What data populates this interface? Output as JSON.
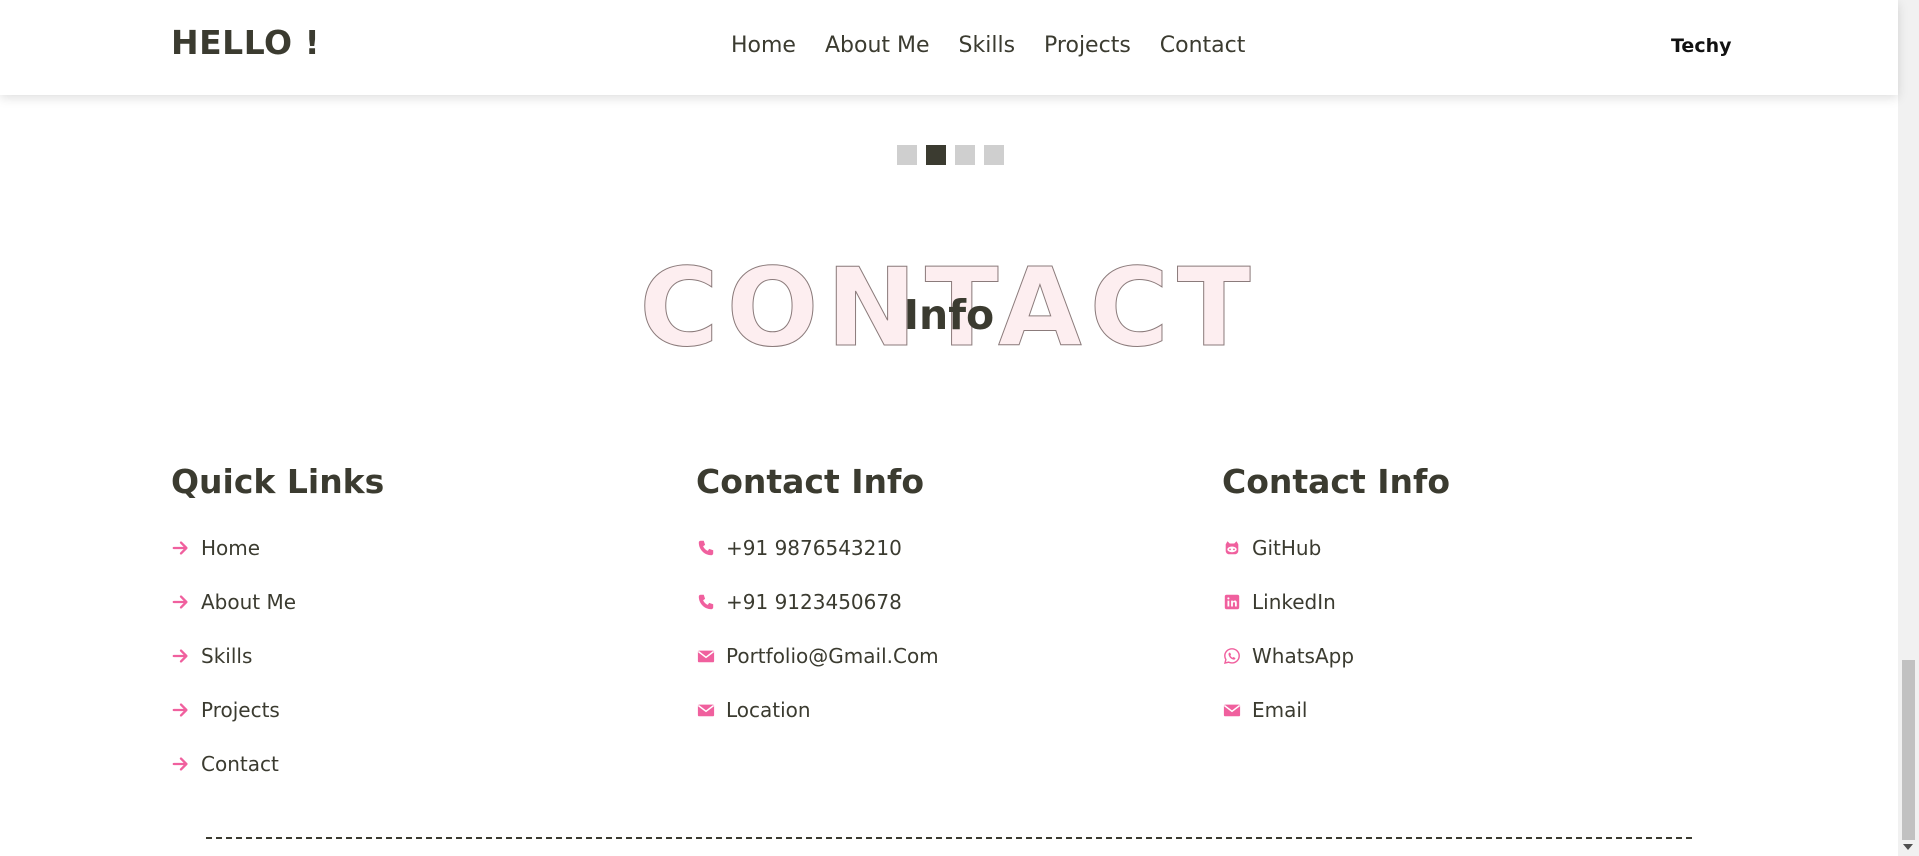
{
  "header": {
    "logo": "HELLO !",
    "nav": [
      "Home",
      "About Me",
      "Skills",
      "Projects",
      "Contact"
    ],
    "brand_right": "Techy"
  },
  "slider": {
    "dot_count": 4,
    "active_index": 1
  },
  "section": {
    "background_title": "CONTACT",
    "title": "Info"
  },
  "columns": [
    {
      "title": "Quick Links",
      "items": [
        {
          "icon": "arrow-right-icon",
          "label": "Home"
        },
        {
          "icon": "arrow-right-icon",
          "label": "About Me"
        },
        {
          "icon": "arrow-right-icon",
          "label": "Skills"
        },
        {
          "icon": "arrow-right-icon",
          "label": "Projects"
        },
        {
          "icon": "arrow-right-icon",
          "label": "Contact"
        }
      ]
    },
    {
      "title": "Contact Info",
      "items": [
        {
          "icon": "phone-icon",
          "label": "+91 9876543210"
        },
        {
          "icon": "phone-icon",
          "label": "+91 9123450678"
        },
        {
          "icon": "envelope-icon",
          "label": "Portfolio@Gmail.Com"
        },
        {
          "icon": "envelope-icon",
          "label": "Location"
        }
      ]
    },
    {
      "title": "Contact Info",
      "items": [
        {
          "icon": "github-icon",
          "label": "GitHub"
        },
        {
          "icon": "linkedin-icon",
          "label": "LinkedIn"
        },
        {
          "icon": "whatsapp-icon",
          "label": "WhatsApp"
        },
        {
          "icon": "envelope-icon",
          "label": "Email"
        }
      ]
    }
  ],
  "colors": {
    "accent": "#f0609e",
    "text": "#3b3b30",
    "dot_inactive": "#cfcfcf",
    "dot_active": "#3b3b30"
  }
}
